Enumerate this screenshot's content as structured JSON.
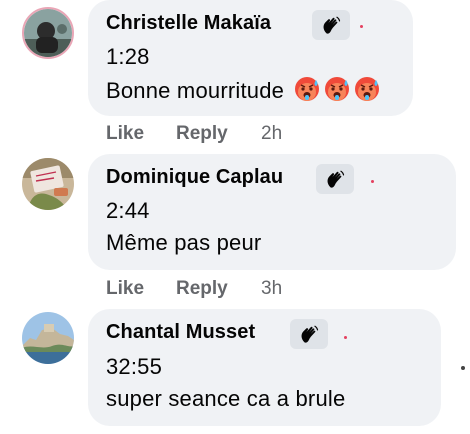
{
  "comments": [
    {
      "author": "Christelle Makaïa",
      "timestamp_line": "1:28",
      "text": "Bonne mourritude",
      "emoji_icons": [
        "hot-face-emoji",
        "hot-face-emoji",
        "hot-face-emoji"
      ],
      "like_label": "Like",
      "reply_label": "Reply",
      "age": "2h"
    },
    {
      "author": "Dominique Caplau",
      "timestamp_line": "2:44",
      "text": "Même pas peur",
      "like_label": "Like",
      "reply_label": "Reply",
      "age": "3h"
    },
    {
      "author": "Chantal Musset",
      "timestamp_line": "32:55",
      "text": "super seance ca a brule"
    }
  ],
  "badge_icon": "waving-hand-icon",
  "colors": {
    "bubble": "#f0f2f5",
    "action_text": "#65676b",
    "badge_bg": "#dfe3e8",
    "notify_dot": "#e4405f"
  }
}
